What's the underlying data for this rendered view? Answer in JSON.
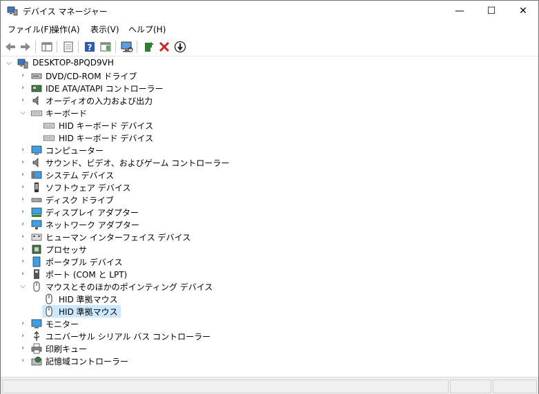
{
  "window": {
    "title": "デバイス マネージャー"
  },
  "controls": {
    "minimize": "—",
    "maximize": "☐",
    "close": "✕"
  },
  "menu": [
    "ファイル(F)",
    "操作(A)",
    "表示(V)",
    "ヘルプ(H)"
  ],
  "tree": {
    "root": "DESKTOP-8PQD9VH",
    "rows": [
      {
        "label": "DVD/CD-ROM ドライブ",
        "icon": "dvd-drive-icon",
        "expanded": false,
        "level": 1
      },
      {
        "label": "IDE ATA/ATAPI コントローラー",
        "icon": "ide-controller-icon",
        "expanded": false,
        "level": 1
      },
      {
        "label": "オーディオの入力および出力",
        "icon": "speaker-icon",
        "expanded": false,
        "level": 1
      },
      {
        "label": "キーボード",
        "icon": "keyboard-icon",
        "expanded": true,
        "level": 1
      },
      {
        "label": "HID キーボード デバイス",
        "icon": "keyboard-icon",
        "level": 2
      },
      {
        "label": "HID キーボード デバイス",
        "icon": "keyboard-icon",
        "level": 2
      },
      {
        "label": "コンピューター",
        "icon": "computer-icon",
        "expanded": false,
        "level": 1
      },
      {
        "label": "サウンド、ビデオ、およびゲーム コントローラー",
        "icon": "speaker-icon",
        "expanded": false,
        "level": 1
      },
      {
        "label": "システム デバイス",
        "icon": "system-device-icon",
        "expanded": false,
        "level": 1
      },
      {
        "label": "ソフトウェア デバイス",
        "icon": "software-device-icon",
        "expanded": false,
        "level": 1
      },
      {
        "label": "ディスク ドライブ",
        "icon": "disk-drive-icon",
        "expanded": false,
        "level": 1
      },
      {
        "label": "ディスプレイ アダプター",
        "icon": "display-adapter-icon",
        "expanded": false,
        "level": 1
      },
      {
        "label": "ネットワーク アダプター",
        "icon": "network-adapter-icon",
        "expanded": false,
        "level": 1
      },
      {
        "label": "ヒューマン インターフェイス デバイス",
        "icon": "hid-icon",
        "expanded": false,
        "level": 1
      },
      {
        "label": "プロセッサ",
        "icon": "processor-icon",
        "expanded": false,
        "level": 1
      },
      {
        "label": "ポータブル デバイス",
        "icon": "portable-device-icon",
        "expanded": false,
        "level": 1
      },
      {
        "label": "ポート (COM と LPT)",
        "icon": "port-icon",
        "expanded": false,
        "level": 1
      },
      {
        "label": "マウスとそのほかのポインティング デバイス",
        "icon": "mouse-icon",
        "expanded": true,
        "level": 1
      },
      {
        "label": "HID 準拠マウス",
        "icon": "mouse-icon",
        "level": 2
      },
      {
        "label": "HID 準拠マウス",
        "icon": "mouse-icon",
        "level": 2,
        "selected": true
      },
      {
        "label": "モニター",
        "icon": "monitor-icon",
        "expanded": false,
        "level": 1
      },
      {
        "label": "ユニバーサル シリアル バス コントローラー",
        "icon": "usb-icon",
        "expanded": false,
        "level": 1
      },
      {
        "label": "印刷キュー",
        "icon": "printer-icon",
        "expanded": false,
        "level": 1
      },
      {
        "label": "記憶域コントローラー",
        "icon": "storage-controller-icon",
        "expanded": false,
        "level": 1
      }
    ]
  },
  "colors": {
    "selection": "#cce8ff",
    "delete_red": "#d32020",
    "help_blue": "#2a5db0"
  }
}
